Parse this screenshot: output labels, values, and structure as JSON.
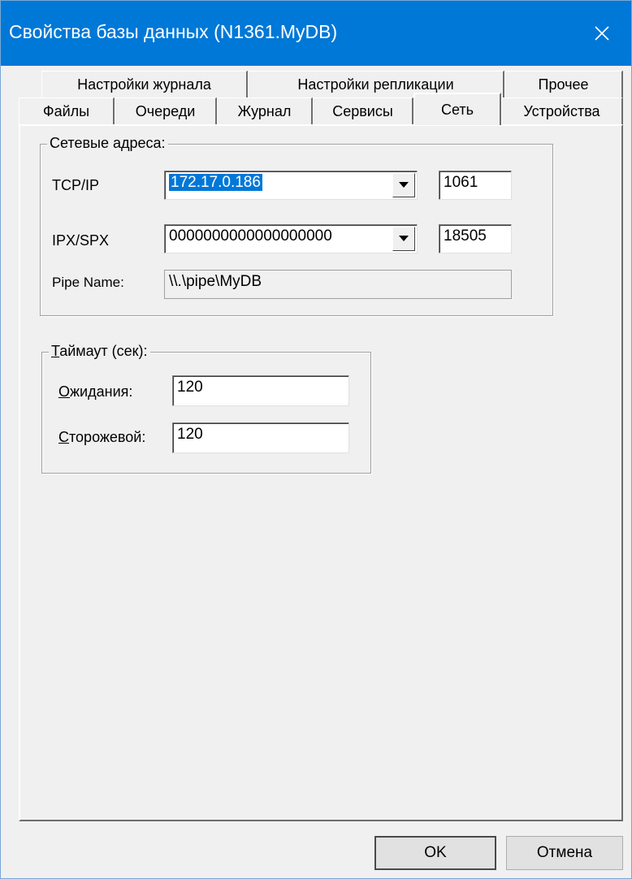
{
  "window": {
    "title": "Свойства базы данных (N1361.MyDB)"
  },
  "tabs_top": [
    "Настройки журнала",
    "Настройки репликации",
    "Прочее"
  ],
  "tabs_bottom": [
    "Файлы",
    "Очереди",
    "Журнал",
    "Сервисы",
    "Сеть",
    "Устройства"
  ],
  "active_tab": "Сеть",
  "network": {
    "legend": "Сетевые адреса:",
    "tcp_label": "TCP/IP",
    "tcp_address": "172.17.0.186",
    "tcp_port": "1061",
    "ipx_label": "IPX/SPX",
    "ipx_address": "0000000000000000000",
    "ipx_port": "18505",
    "pipe_label": "Pipe Name:",
    "pipe_value": "\\\\.\\pipe\\MyDB"
  },
  "timeout": {
    "legend_first": "Т",
    "legend_rest": "аймаут (сек):",
    "wait_first": "О",
    "wait_rest": "жидания:",
    "wait_value": "120",
    "watchdog_first": "С",
    "watchdog_rest": "торожевой:",
    "watchdog_value": "120"
  },
  "buttons": {
    "ok": "OK",
    "cancel": "Отмена"
  },
  "colors": {
    "titlebar": "#0078d7",
    "selection": "#0078d7",
    "face": "#f0f0f0"
  }
}
